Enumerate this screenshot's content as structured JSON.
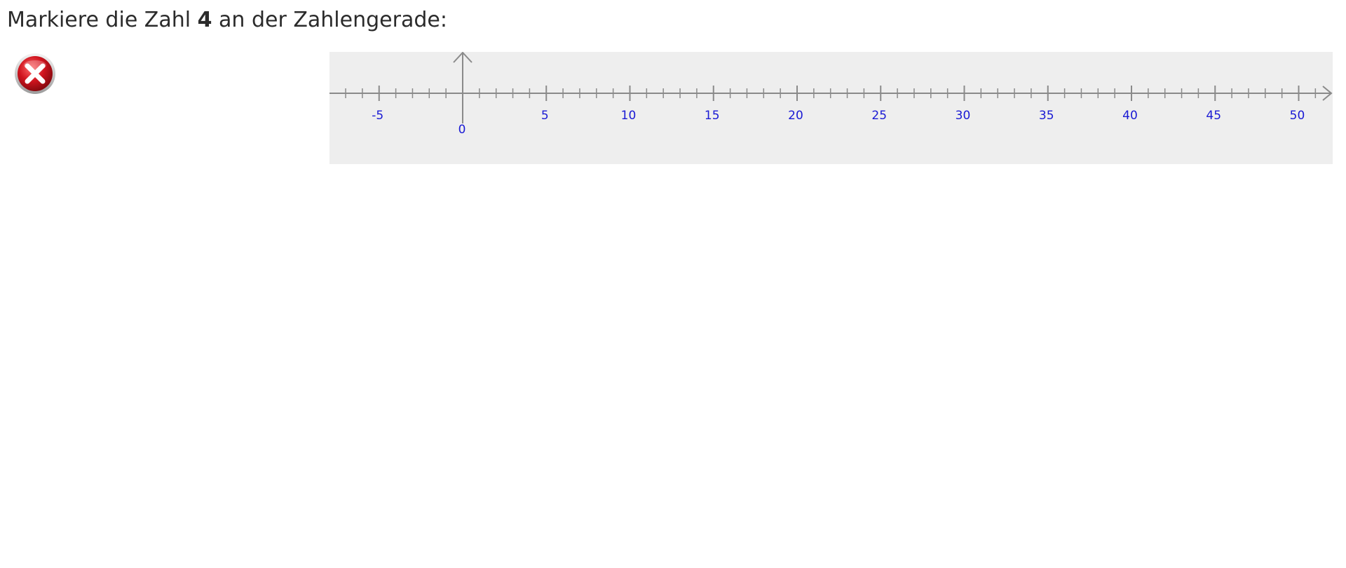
{
  "question": {
    "prefix": "Markiere die Zahl ",
    "number": "4",
    "suffix": " an der Zahlengerade:"
  },
  "feedback": {
    "icon": "error-x-icon",
    "state": "incorrect",
    "color": "#d0141e"
  },
  "numberline": {
    "min": -8,
    "max": 52,
    "minor_step": 1,
    "major_step": 5,
    "labels": [
      "-5",
      "0",
      "5",
      "10",
      "15",
      "20",
      "25",
      "30",
      "35",
      "40",
      "45",
      "50"
    ],
    "axis_color": "#8a8a8a",
    "label_color": "#1a1ad4",
    "background": "#eeeeee"
  }
}
